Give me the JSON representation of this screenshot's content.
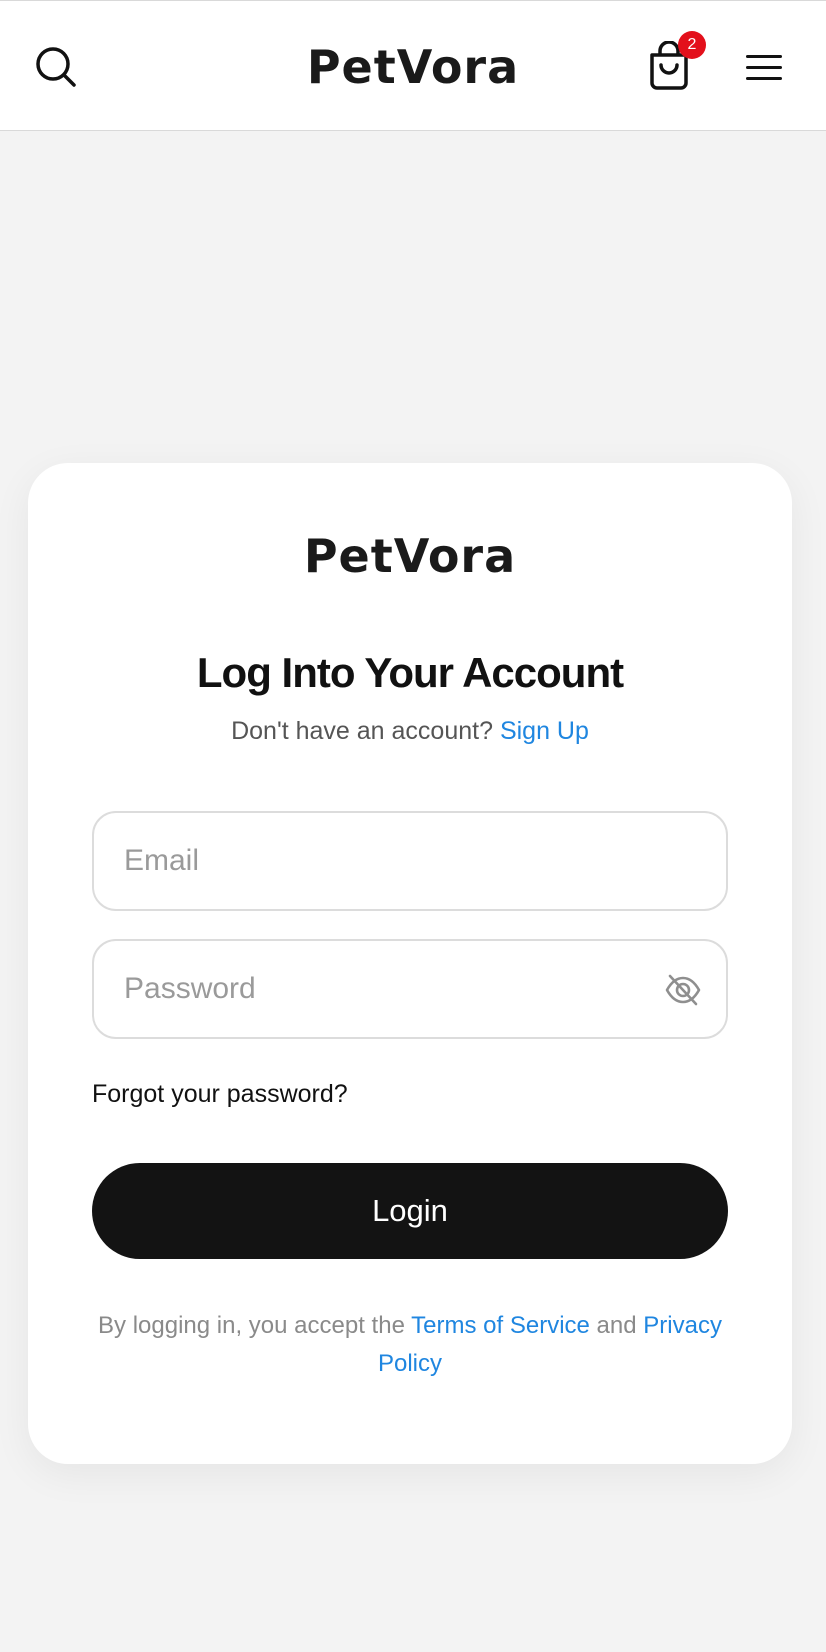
{
  "header": {
    "brand": "PetVora",
    "cart_count": "2"
  },
  "login_card": {
    "logo": "PetVora",
    "title": "Log Into Your Account",
    "signup_prompt": "Don't have an account?",
    "signup_link": "Sign Up",
    "email_placeholder": "Email",
    "email_value": "",
    "password_placeholder": "Password",
    "password_value": "",
    "forgot_link": "Forgot your password?",
    "login_button": "Login",
    "terms_prefix": "By logging in, you accept the",
    "terms_link": "Terms of Service",
    "terms_and": "and",
    "privacy_link": "Privacy Policy"
  },
  "icons": {
    "search": "search-icon",
    "cart": "shopping-bag-icon",
    "menu": "hamburger-menu-icon",
    "password_toggle": "eye-slash-icon"
  },
  "colors": {
    "link": "#1f86e0",
    "badge": "#e3101b",
    "button": "#131313",
    "background": "#f3f3f3"
  }
}
